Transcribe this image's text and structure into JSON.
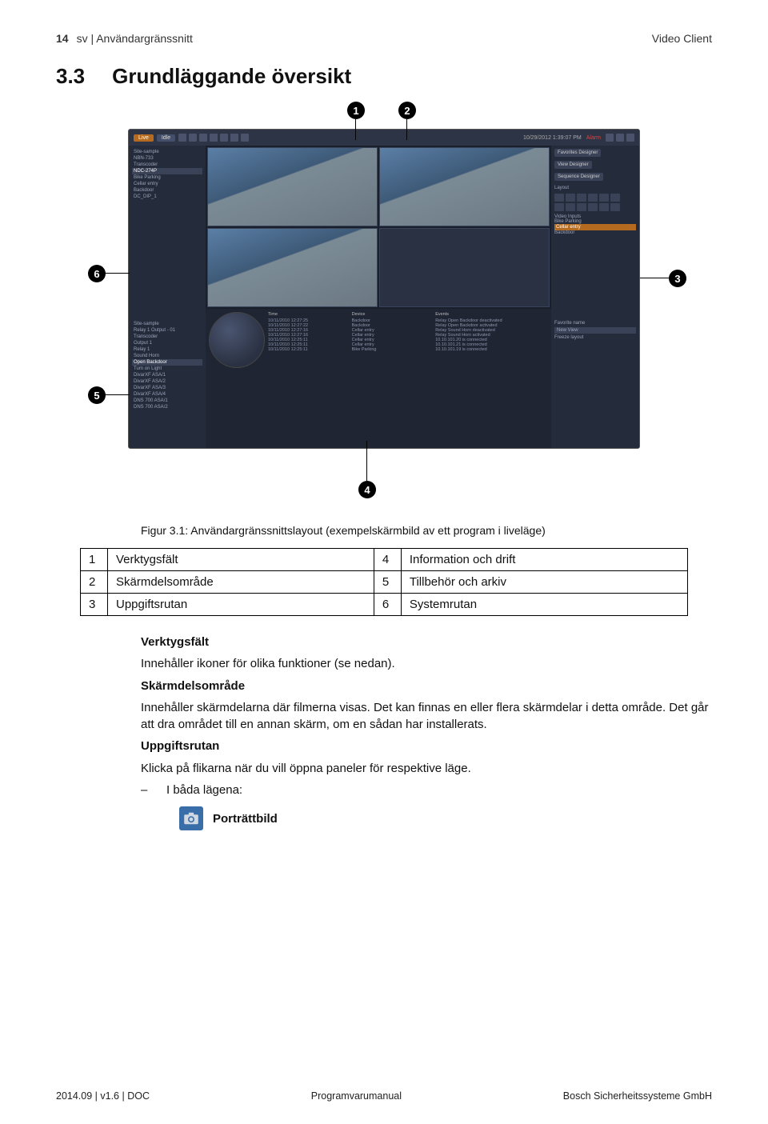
{
  "header": {
    "page_num": "14",
    "breadcrumb": "sv | Användargränssnitt",
    "product": "Video Client"
  },
  "section": {
    "number": "3.3",
    "title": "Grundläggande översikt"
  },
  "figure": {
    "caption": "Figur 3.1: Användargränssnittslayout (exempelskärmbild av ett program i liveläge)",
    "callouts": {
      "c1": "1",
      "c2": "2",
      "c3": "3",
      "c4": "4",
      "c5": "5",
      "c6": "6"
    },
    "app": {
      "mode_live": "Live",
      "mode_idle": "Idle",
      "datetime": "10/29/2012 1:39:07 PM",
      "alarm": "Alarm",
      "sidebar_left_items": [
        "Site-sample",
        "NBN-733",
        "Transcoder",
        "NDC-274P",
        "Bike Parking",
        "Cellar entry",
        "Backdoor",
        "DC_DIP_1"
      ],
      "right_tab1": "Favorites Designer",
      "right_tab2": "View Designer",
      "right_tab3": "Sequence Designer",
      "right_section": "Layout",
      "right_inputs": "Video Inputs",
      "right_input_items": [
        "Bike Parking",
        "Cellar entry",
        "Backdoor"
      ],
      "lower_left_items": [
        "Site-sample",
        "Relay 1 Output - 01",
        "Transcoder",
        "Output 1",
        "Relay 1",
        "Sound Horn",
        "Open Backdoor",
        "Turn on Light",
        "DivarXF ASA/1",
        "DivarXF ASA/2",
        "DivarXF ASA/3",
        "DivarXF ASA/4",
        "DNS 700 ASA/1",
        "DNS 700 ASA/2"
      ],
      "time_h": "Time",
      "device_h": "Device",
      "events_h": "Events",
      "time_rows": [
        "10/11/2010 12:27:25",
        "10/11/2010 12:27:22",
        "10/11/2010 12:27:16",
        "10/11/2010 12:27:16",
        "10/11/2010 12:25:11",
        "10/11/2010 12:25:11",
        "10/11/2010 12:25:11"
      ],
      "device_rows": [
        "Backdoor",
        "Backdoor",
        "Cellar entry",
        "Cellar entry",
        "Cellar entry",
        "Cellar entry",
        "Bike Parking"
      ],
      "event_rows": [
        "Relay Open Backdoor deactivated",
        "Relay Open Backdoor activated",
        "Relay Sound Horn deactivated",
        "Relay Sound Horn activated",
        "10.10.101.20 is connected",
        "10.10.101.21 is connected",
        "10.10.101.19 is connected"
      ],
      "fav_name_label": "Favorite name",
      "fav_name_value": "New View",
      "freeze": "Freeze layout"
    }
  },
  "legend": {
    "r1c1n": "1",
    "r1c1": "Verktygsfält",
    "r1c2n": "4",
    "r1c2": "Information och drift",
    "r2c1n": "2",
    "r2c1": "Skärmdelsområde",
    "r2c2n": "5",
    "r2c2": "Tillbehör och arkiv",
    "r3c1n": "3",
    "r3c1": "Uppgiftsrutan",
    "r3c2n": "6",
    "r3c2": "Systemrutan"
  },
  "body": {
    "h1": "Verktygsfält",
    "p1": "Innehåller ikoner för olika funktioner (se nedan).",
    "h2": "Skärmdelsområde",
    "p2": "Innehåller skärmdelarna där filmerna visas. Det kan finnas en eller flera skärmdelar i detta område. Det går att dra området till en annan skärm, om en sådan har installerats.",
    "h3": "Uppgiftsrutan",
    "p3": "Klicka på flikarna när du vill öppna paneler för respektive läge.",
    "li1": "I båda lägena:",
    "portrait": "Porträttbild"
  },
  "footer": {
    "left": "2014.09 | v1.6 | DOC",
    "center": "Programvarumanual",
    "right": "Bosch Sicherheitssysteme GmbH"
  }
}
